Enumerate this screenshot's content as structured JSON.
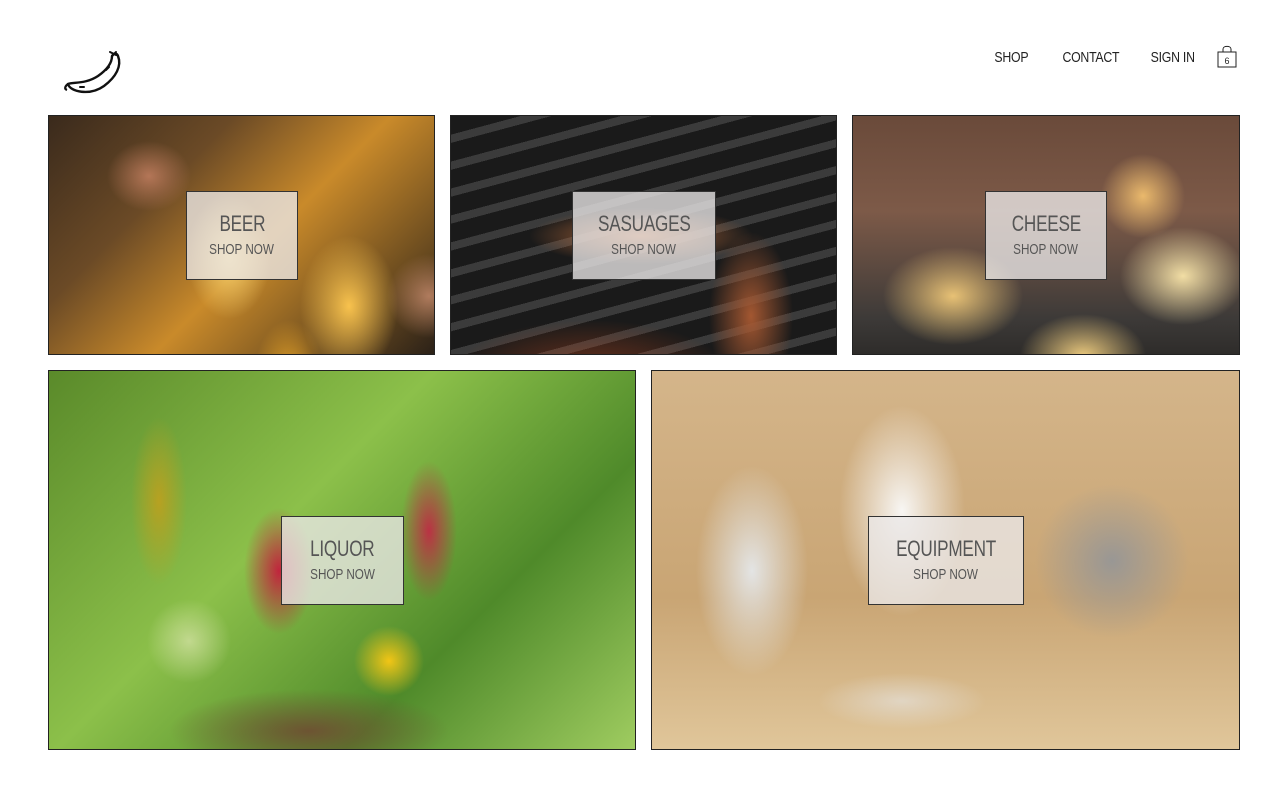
{
  "header": {
    "logo_icon": "sausage-icon",
    "nav": [
      {
        "label": "SHOP"
      },
      {
        "label": "CONTACT"
      },
      {
        "label": "SIGN IN"
      }
    ],
    "cart": {
      "icon": "shopping-bag-icon",
      "count": "6"
    }
  },
  "tiles": [
    {
      "title": "BEER",
      "cta": "SHOP NOW"
    },
    {
      "title": "SASUAGES",
      "cta": "SHOP NOW"
    },
    {
      "title": "CHEESE",
      "cta": "SHOP NOW"
    },
    {
      "title": "LIQUOR",
      "cta": "SHOP NOW"
    },
    {
      "title": "EQUIPMENT",
      "cta": "SHOP NOW"
    }
  ]
}
